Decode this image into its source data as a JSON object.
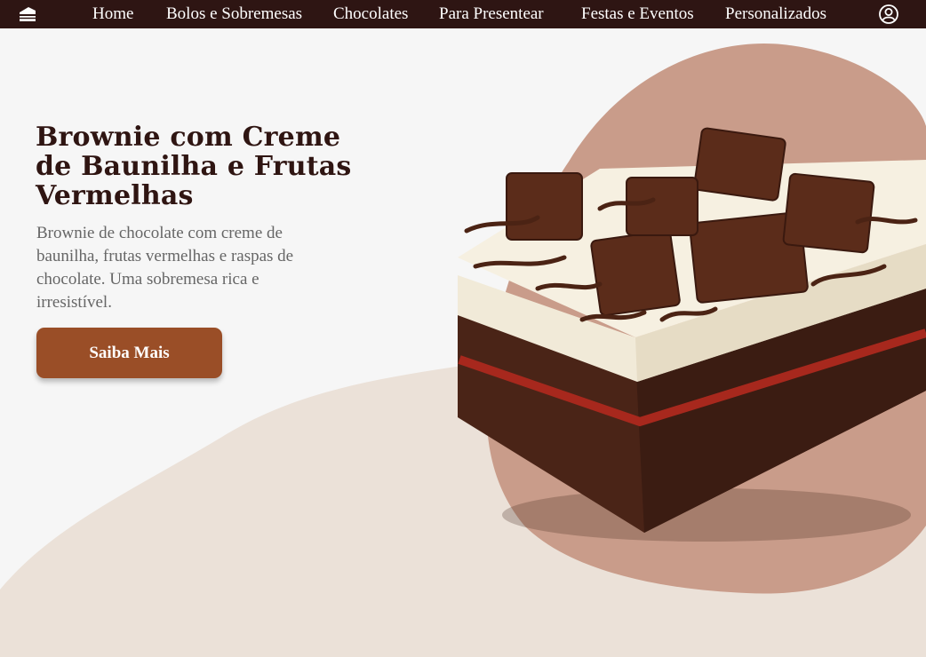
{
  "nav": {
    "logo_icon": "cake-slice-icon",
    "items": [
      {
        "label": "Home"
      },
      {
        "label": "Bolos e Sobremesas"
      },
      {
        "label": "Chocolates"
      },
      {
        "label": "Para Presentear"
      },
      {
        "label": "Festas e Eventos"
      },
      {
        "label": "Personalizados"
      }
    ],
    "user_icon": "user-account-icon"
  },
  "hero": {
    "title": "Brownie com Creme de Baunilha e Frutas Vermelhas",
    "description": "Brownie de chocolate com creme de baunilha, frutas vermelhas e raspas de chocolate. Uma sobremesa rica e irresistível.",
    "button_label": "Saiba Mais"
  },
  "colors": {
    "nav_bg": "#2e1513",
    "title": "#2f1512",
    "button": "#9a4e27",
    "blob_pink": "#c99c8a",
    "blob_beige": "#ebe1d8",
    "page_bg": "#f6f6f6"
  }
}
